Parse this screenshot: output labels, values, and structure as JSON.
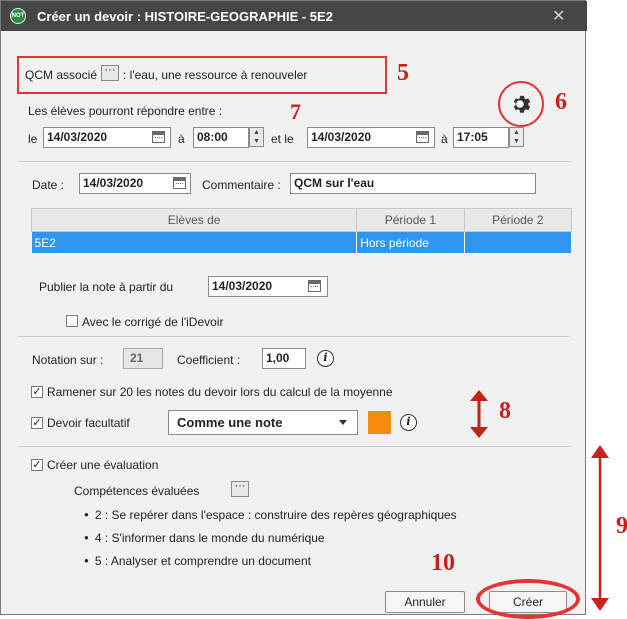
{
  "window": {
    "logo_text": "NOT",
    "title": "Créer un devoir : HISTOIRE-GEOGRAPHIE - 5E2",
    "close_glyph": "✕"
  },
  "qcm": {
    "label": "QCM associé",
    "button_glyph": "···",
    "value": ": l'eau, une ressource à renouveler"
  },
  "window_range": {
    "label": "Les élèves pourront répondre entre :",
    "le_label": "le",
    "start_date": "14/03/2020",
    "a_label_1": "à",
    "start_time": "08:00",
    "et_le_label": "et le",
    "end_date": "14/03/2020",
    "a_label_2": "à",
    "end_time": "17:05"
  },
  "date_row": {
    "date_label": "Date :",
    "date_value": "14/03/2020",
    "comment_label": "Commentaire :",
    "comment_value": "QCM sur l'eau"
  },
  "table": {
    "headers": [
      "Elèves de",
      "Période 1",
      "Période 2"
    ],
    "rows": [
      {
        "class": "5E2",
        "p1": "Hors période",
        "p2": ""
      }
    ]
  },
  "publish": {
    "label": "Publier la note à partir du",
    "date": "14/03/2020",
    "corrige_label": "Avec le corrigé de l'iDevoir",
    "corrige_checked": false
  },
  "notation": {
    "label": "Notation sur :",
    "value": "21",
    "coef_label": "Coefficient :",
    "coef_value": "1,00",
    "info_glyph": "i"
  },
  "ramener": {
    "label": "Ramener sur 20 les notes du devoir lors du calcul de la moyenne",
    "checked": true
  },
  "facultatif": {
    "label": "Devoir facultatif",
    "checked": true,
    "select_value": "Comme une note",
    "color": "#f58a0c",
    "info_glyph": "i"
  },
  "evaluation": {
    "label": "Créer une évaluation",
    "checked": true,
    "competences_label": "Compétences évaluées",
    "button_glyph": "···",
    "items": [
      "2 : Se repérer dans l'espace : construire des repères géographiques",
      "4 : S'informer dans le monde du numérique",
      "5 : Analyser et comprendre un document"
    ]
  },
  "buttons": {
    "cancel": "Annuler",
    "create": "Créer"
  },
  "annotations": {
    "n5": "5",
    "n6": "6",
    "n7": "7",
    "n8": "8",
    "n9": "9",
    "n10": "10",
    "color": "#c8201c"
  },
  "check_glyph": "✓",
  "bullet_glyph": "●"
}
